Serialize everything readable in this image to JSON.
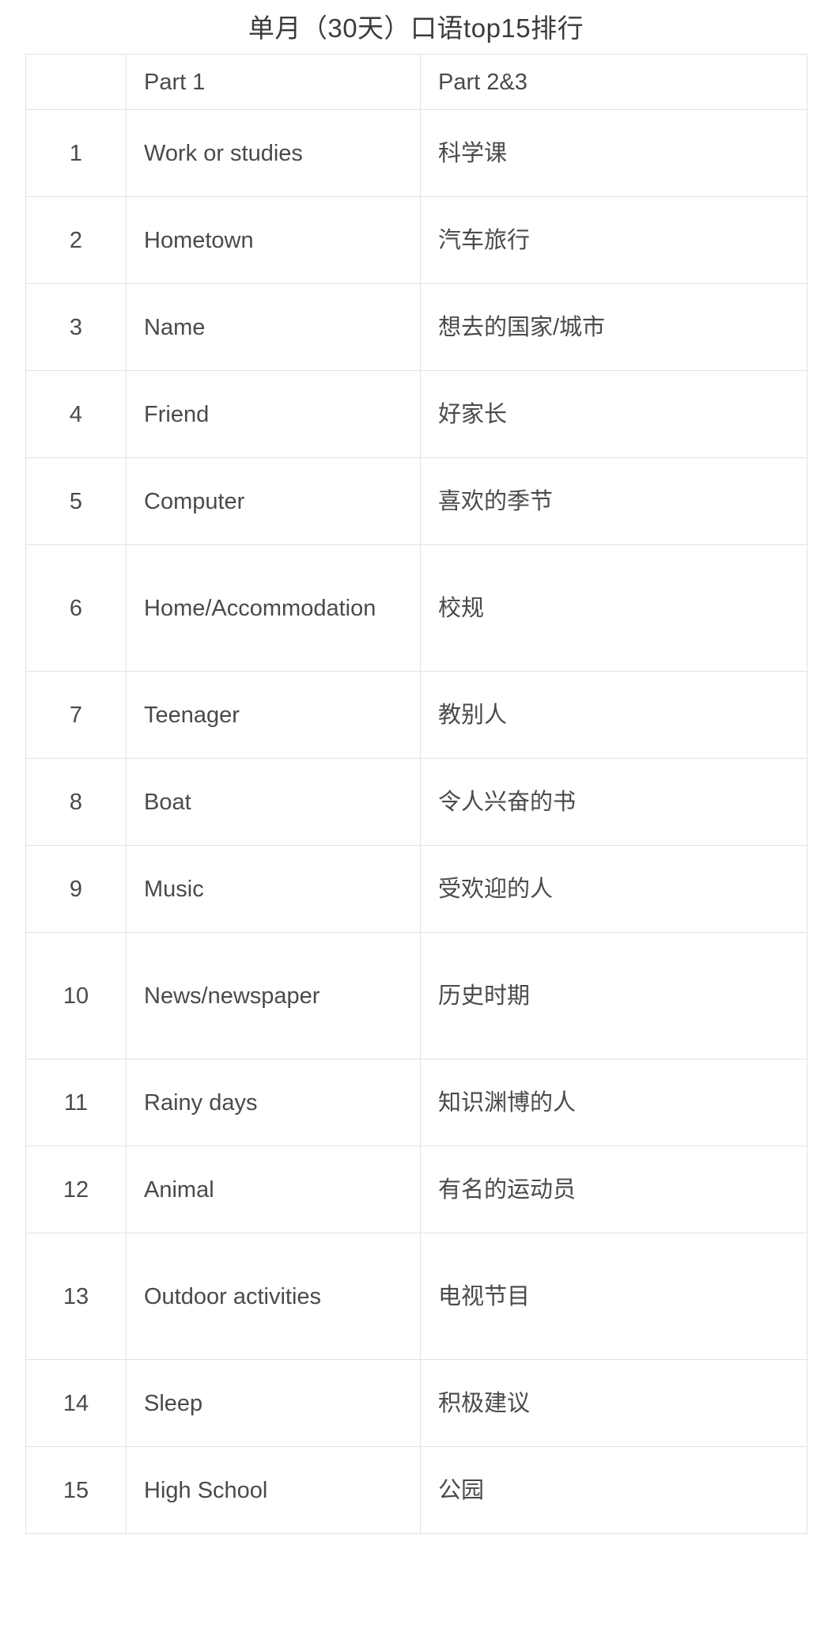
{
  "page": {
    "title": "单月（30天）口语top15排行",
    "background_color": "#ffffff",
    "text_color": "#4a4a4a",
    "border_color": "#e3e3e3"
  },
  "table": {
    "columns": [
      {
        "key": "rank",
        "label": ""
      },
      {
        "key": "part1",
        "label": "Part 1"
      },
      {
        "key": "part23",
        "label": "Part 2&3"
      }
    ],
    "rows": [
      {
        "rank": "1",
        "part1": "Work or studies",
        "part23": "科学课"
      },
      {
        "rank": "2",
        "part1": "Hometown",
        "part23": "汽车旅行"
      },
      {
        "rank": "3",
        "part1": "Name",
        "part23": "想去的国家/城市"
      },
      {
        "rank": "4",
        "part1": "Friend",
        "part23": "好家长"
      },
      {
        "rank": "5",
        "part1": "Computer",
        "part23": "喜欢的季节"
      },
      {
        "rank": "6",
        "part1": "Home/Accommodation",
        "part23": "校规"
      },
      {
        "rank": "7",
        "part1": "Teenager",
        "part23": "教别人"
      },
      {
        "rank": "8",
        "part1": "Boat",
        "part23": "令人兴奋的书"
      },
      {
        "rank": "9",
        "part1": "Music",
        "part23": "受欢迎的人"
      },
      {
        "rank": "10",
        "part1": "News/newspaper",
        "part23": "历史时期"
      },
      {
        "rank": "11",
        "part1": "Rainy days",
        "part23": "知识渊博的人"
      },
      {
        "rank": "12",
        "part1": "Animal",
        "part23": "有名的运动员"
      },
      {
        "rank": "13",
        "part1": "Outdoor activities",
        "part23": "电视节目"
      },
      {
        "rank": "14",
        "part1": "Sleep",
        "part23": "积极建议"
      },
      {
        "rank": "15",
        "part1": "High School",
        "part23": "公园"
      }
    ]
  }
}
